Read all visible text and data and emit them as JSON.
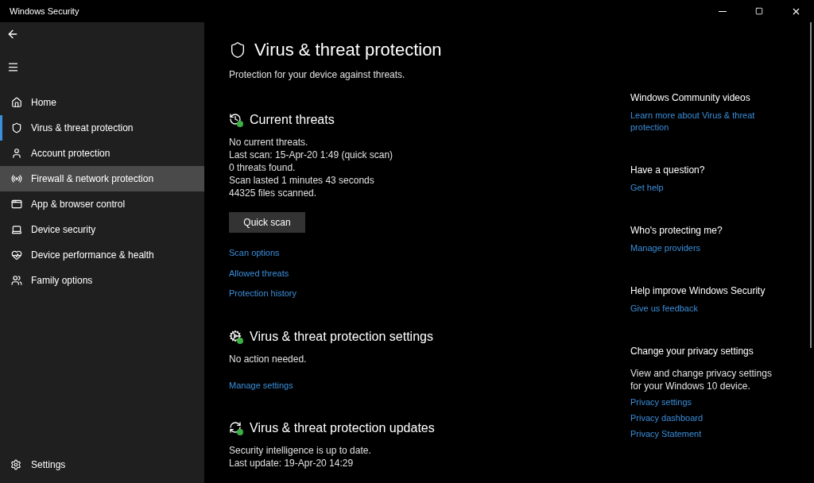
{
  "window": {
    "title": "Windows Security"
  },
  "sidebar": {
    "items": [
      {
        "label": "Home",
        "kind": "home",
        "selected": false,
        "hovered": false
      },
      {
        "label": "Virus & threat protection",
        "kind": "shield",
        "selected": true,
        "hovered": false
      },
      {
        "label": "Account protection",
        "kind": "person",
        "selected": false,
        "hovered": false
      },
      {
        "label": "Firewall & network protection",
        "kind": "antenna",
        "selected": false,
        "hovered": true
      },
      {
        "label": "App & browser control",
        "kind": "window",
        "selected": false,
        "hovered": false
      },
      {
        "label": "Device security",
        "kind": "laptop",
        "selected": false,
        "hovered": false
      },
      {
        "label": "Device performance & health",
        "kind": "heart",
        "selected": false,
        "hovered": false
      },
      {
        "label": "Family options",
        "kind": "family",
        "selected": false,
        "hovered": false
      }
    ],
    "settings": "Settings"
  },
  "page": {
    "title": "Virus & threat protection",
    "subtitle": "Protection for your device against threats.",
    "sections": [
      {
        "kind": "threats",
        "title": "Current threats",
        "lines": [
          "No current threats.",
          "Last scan: 15-Apr-20 1:49 (quick scan)",
          "0 threats found.",
          "Scan lasted 1 minutes 43 seconds",
          "44325 files scanned."
        ],
        "button": "Quick scan",
        "links": [
          "Scan options",
          "Allowed threats",
          "Protection history"
        ]
      },
      {
        "kind": "settings",
        "title": "Virus & threat protection settings",
        "lines": [
          "No action needed."
        ],
        "links": [
          "Manage settings"
        ]
      },
      {
        "kind": "updates",
        "title": "Virus & threat protection updates",
        "lines": [
          "Security intelligence is up to date.",
          "Last update: 19-Apr-20 14:29"
        ]
      }
    ]
  },
  "aside": [
    {
      "heading": "Windows Community videos",
      "links": [
        "Learn more about Virus & threat protection"
      ]
    },
    {
      "heading": "Have a question?",
      "links": [
        "Get help"
      ]
    },
    {
      "heading": "Who's protecting me?",
      "links": [
        "Manage providers"
      ]
    },
    {
      "heading": "Help improve Windows Security",
      "links": [
        "Give us feedback"
      ]
    },
    {
      "heading": "Change your privacy settings",
      "text": "View and change privacy settings for your Windows 10 device.",
      "links": [
        "Privacy settings",
        "Privacy dashboard",
        "Privacy Statement"
      ]
    }
  ]
}
